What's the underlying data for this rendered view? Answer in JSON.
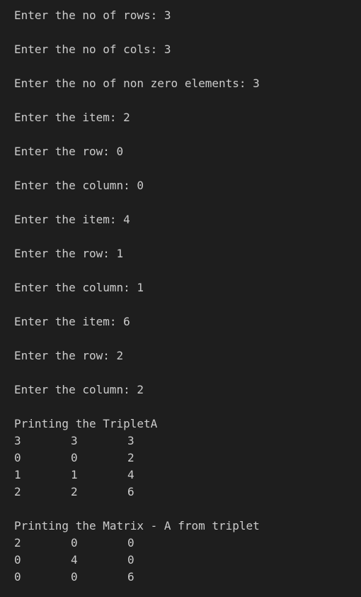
{
  "prompts": [
    "Enter the no of rows: 3",
    "Enter the no of cols: 3",
    "Enter the no of non zero elements: 3",
    "Enter the item: 2",
    "Enter the row: 0",
    "Enter the column: 0",
    "Enter the item: 4",
    "Enter the row: 1",
    "Enter the column: 1",
    "Enter the item: 6",
    "Enter the row: 2",
    "Enter the column: 2"
  ],
  "triplet": {
    "heading": "Printing the TripletA",
    "rows": [
      [
        "3",
        "3",
        "3"
      ],
      [
        "0",
        "0",
        "2"
      ],
      [
        "1",
        "1",
        "4"
      ],
      [
        "2",
        "2",
        "6"
      ]
    ]
  },
  "matrix": {
    "heading": "Printing the Matrix - A from triplet",
    "rows": [
      [
        "2",
        "0",
        "0"
      ],
      [
        "0",
        "4",
        "0"
      ],
      [
        "0",
        "0",
        "6"
      ]
    ]
  }
}
